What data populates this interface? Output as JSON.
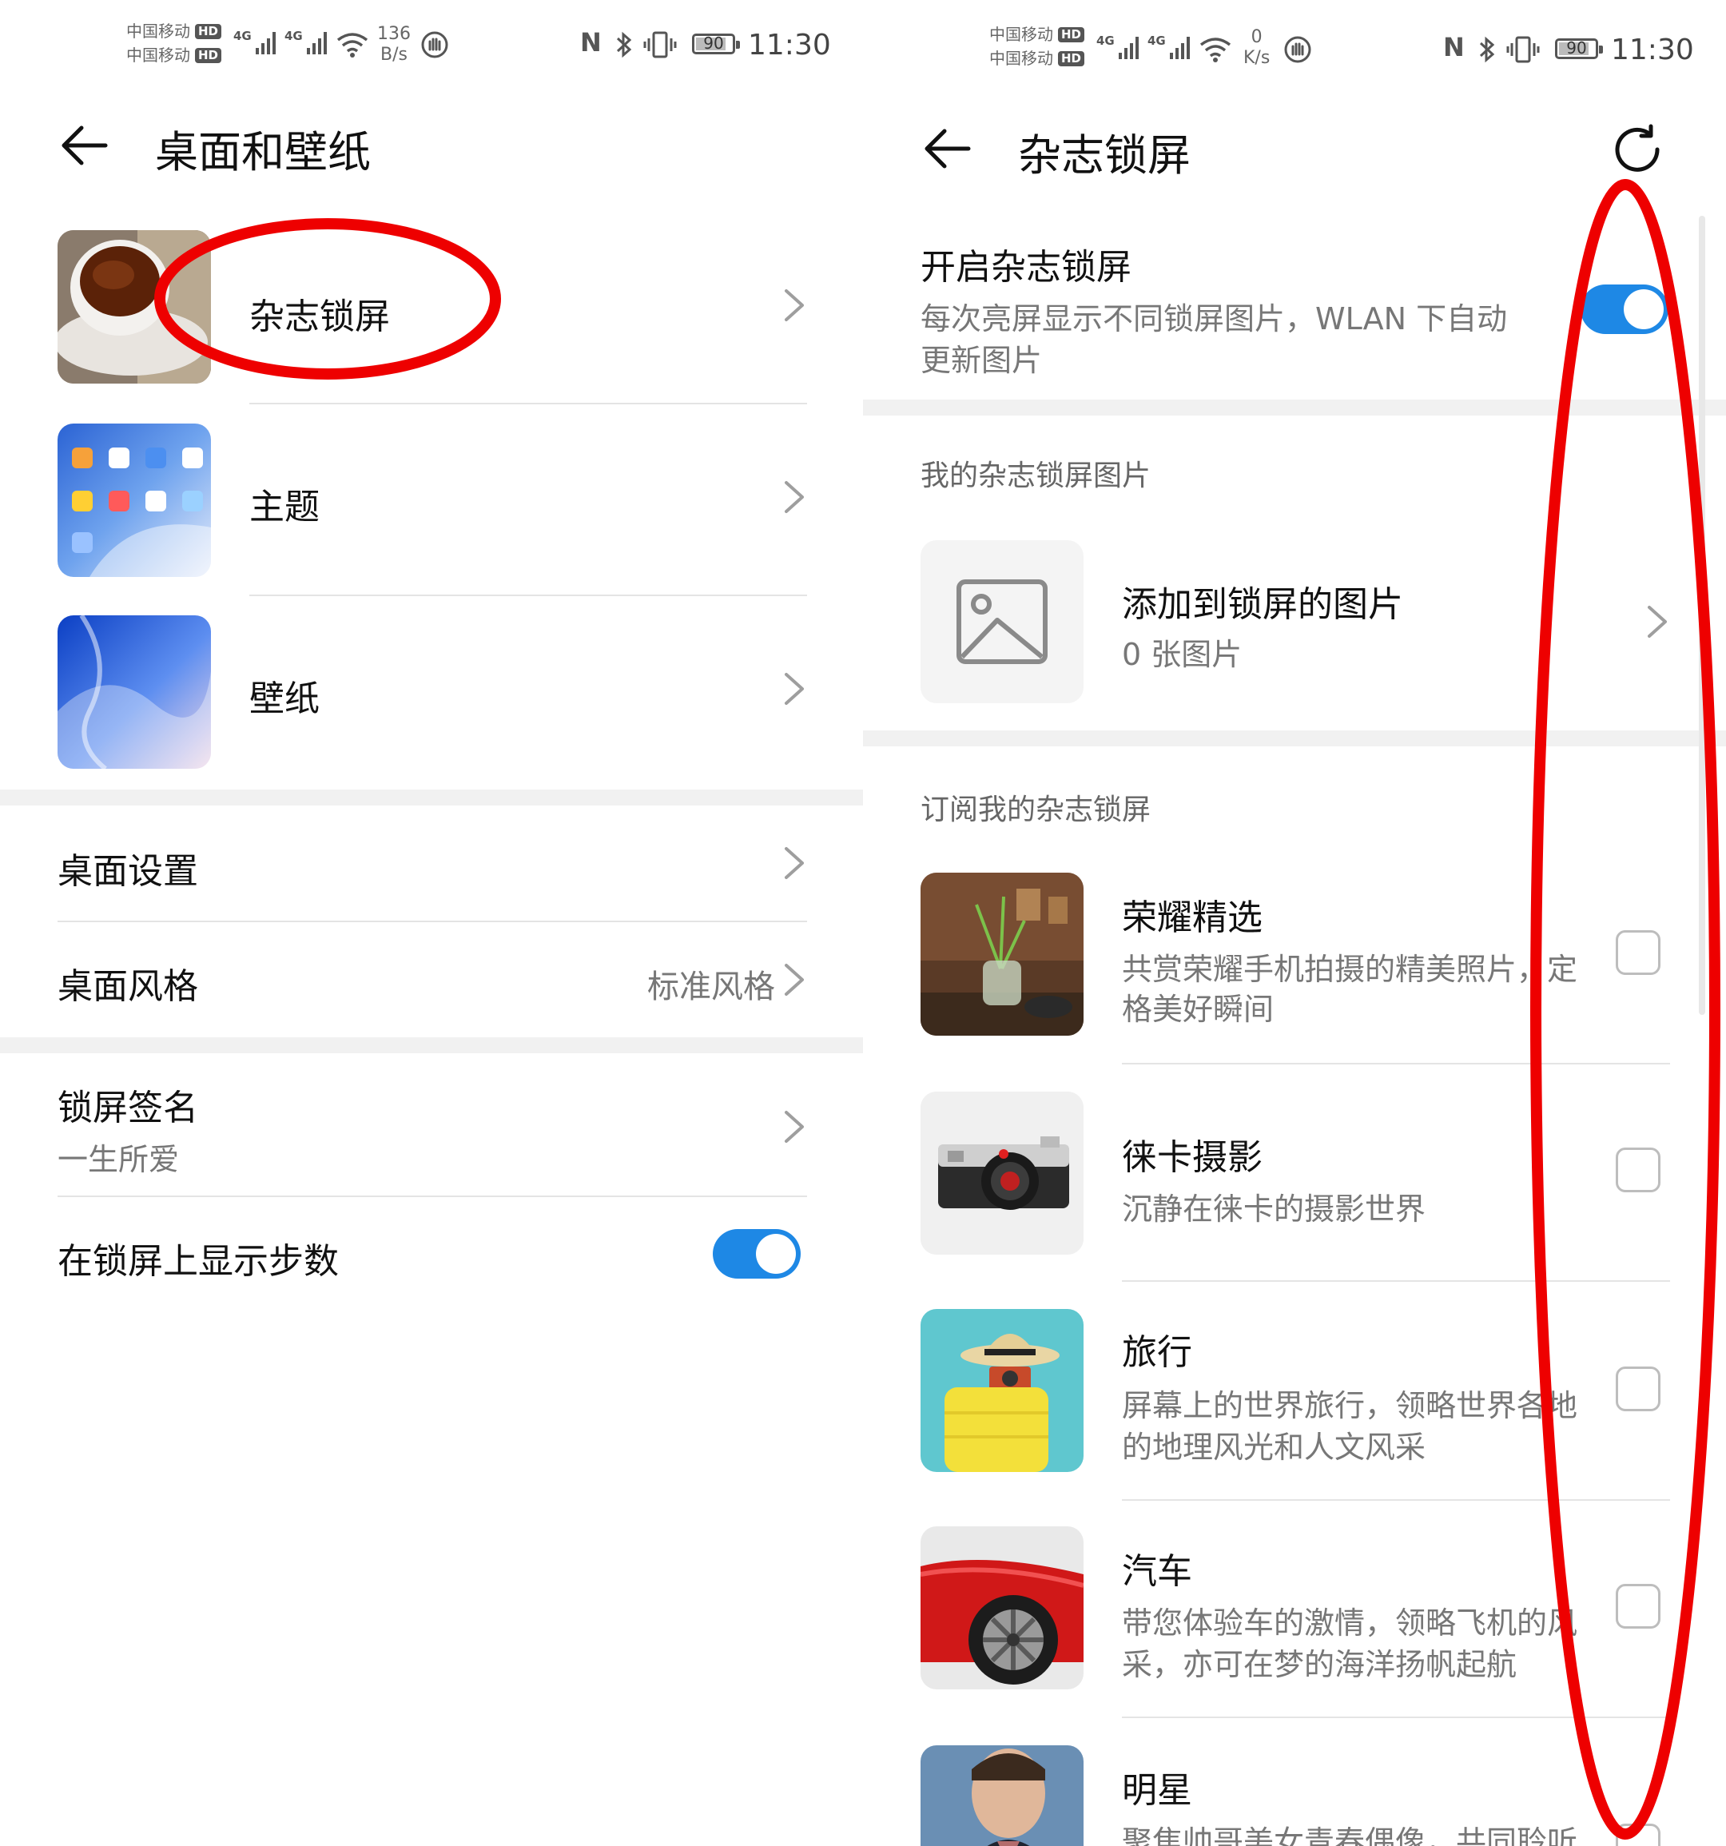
{
  "left": {
    "status": {
      "carrier1": "中国移动",
      "carrier2": "中国移动",
      "hd": "HD",
      "net1": "4G",
      "net2": "4G",
      "speed_value": "136",
      "speed_unit": "B/s",
      "battery": "90",
      "time": "11:30"
    },
    "title": "桌面和壁纸",
    "menu_items": [
      {
        "label": "杂志锁屏",
        "thumb": "tea-cup-image"
      },
      {
        "label": "主题",
        "thumb": "theme-preview-image"
      },
      {
        "label": "壁纸",
        "thumb": "blue-wallpaper-image"
      }
    ],
    "desktop_settings": "桌面设置",
    "desktop_style": {
      "label": "桌面风格",
      "value": "标准风格"
    },
    "lock_signature": {
      "label": "锁屏签名",
      "value": "一生所爱"
    },
    "show_steps": {
      "label": "在锁屏上显示步数",
      "enabled": true
    }
  },
  "right": {
    "status": {
      "carrier1": "中国移动",
      "carrier2": "中国移动",
      "hd": "HD",
      "net1": "4G",
      "net2": "4G",
      "speed_value": "0",
      "speed_unit": "K/s",
      "battery": "90",
      "time": "11:30"
    },
    "title": "杂志锁屏",
    "enable": {
      "title": "开启杂志锁屏",
      "desc1": "每次亮屏显示不同锁屏图片，WLAN 下自动",
      "desc2": "更新图片",
      "enabled": true
    },
    "my_images": {
      "header": "我的杂志锁屏图片",
      "title": "添加到锁屏的图片",
      "count": "0 张图片"
    },
    "subscribe_header": "订阅我的杂志锁屏",
    "channels": [
      {
        "title": "荣耀精选",
        "desc1": "共赏荣耀手机拍摄的精美照片，定",
        "desc2": "格美好瞬间",
        "checked": false
      },
      {
        "title": "徕卡摄影",
        "desc1": "沉静在徕卡的摄影世界",
        "desc2": "",
        "checked": false
      },
      {
        "title": "旅行",
        "desc1": "屏幕上的世界旅行，领略世界各地",
        "desc2": "的地理风光和人文风采",
        "checked": false
      },
      {
        "title": "汽车",
        "desc1": "带您体验车的激情，领略飞机的风",
        "desc2": "采，亦可在梦的海洋扬帆起航",
        "checked": false
      },
      {
        "title": "明星",
        "desc1": "聚焦帅哥美女青春偶像，共同聆听",
        "desc2": "",
        "checked": false
      }
    ]
  },
  "colors": {
    "accent": "#1e88e5",
    "annotation": "#ee0000",
    "divider": "#e4e4e4",
    "secondary_text": "#777777"
  }
}
